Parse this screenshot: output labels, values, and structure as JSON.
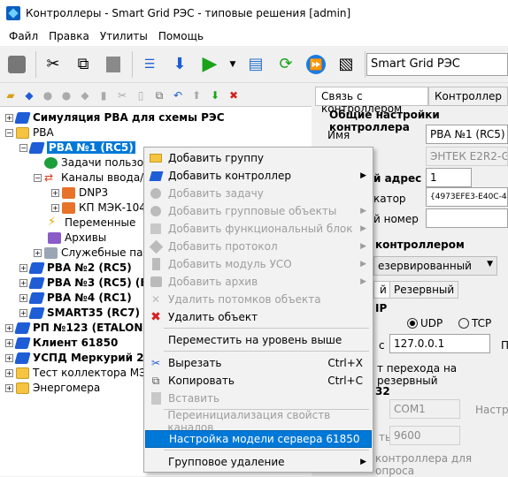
{
  "window": {
    "title": "Контроллеры - Smart Grid РЭС - типовые решения [admin]"
  },
  "menubar": [
    "Файл",
    "Правка",
    "Утилиты",
    "Помощь"
  ],
  "toolbar": {
    "profile": "Smart Grid РЭС"
  },
  "tree": {
    "items": [
      {
        "label": "Симуляция РВА для схемы РЭС",
        "bold": true
      },
      {
        "label": "РВА",
        "bold": false
      },
      {
        "label": "РВА №1 (RC5)",
        "bold": true
      },
      {
        "label": "Задачи пользо",
        "bold": false
      },
      {
        "label": "Каналы ввода/в",
        "bold": false
      },
      {
        "label": "DNP3",
        "bold": false
      },
      {
        "label": "КП МЭК-104",
        "bold": false
      },
      {
        "label": "Переменные",
        "bold": false
      },
      {
        "label": "Архивы",
        "bold": false
      },
      {
        "label": "Служебные па",
        "bold": false
      },
      {
        "label": "РВА №2 (RC5)",
        "bold": true
      },
      {
        "label": "РВА №3 (RC5) (E1",
        "bold": true
      },
      {
        "label": "РВА №4 (RC1)",
        "bold": true
      },
      {
        "label": "SMART35 (RC7)",
        "bold": true
      },
      {
        "label": "РП №123 (ETALON)",
        "bold": true
      },
      {
        "label": "Клиент 61850",
        "bold": true
      },
      {
        "label": "УСПД Меркурий 250",
        "bold": true
      },
      {
        "label": "Тест коллектора МЭК",
        "bold": false
      },
      {
        "label": "Энергомера",
        "bold": false
      }
    ]
  },
  "right_panel": {
    "tabs": [
      "Связь с контроллером",
      "Контроллер"
    ],
    "section_general": "Общие настройки контроллера",
    "name_label": "Имя",
    "name_value": "РВА №1 (RC5)",
    "model_value": "ЭНТЕК E2R2-G",
    "addr_label": "й адрес",
    "addr_value": "1",
    "id_label": "катор",
    "id_value": "{4973EFE3-E40C-447",
    "num_label": "й номер",
    "section_link": "контроллером",
    "mode_value": "езервированный",
    "subtabs": [
      "й",
      "Резервный"
    ],
    "proto_label": "IP",
    "udp": "UDP",
    "tcp": "TCP",
    "ip_label": "с",
    "ip_value": "127.0.0.1",
    "port_label": "П",
    "switch_label": "т перехода на резервный",
    "section_serial": "32",
    "com_value": "COM1",
    "settings_label": "Настро",
    "baud_label": "ть",
    "baud_value": "9600",
    "bottom_text": "контроллера для опроса"
  },
  "context_menu": {
    "items": [
      {
        "label": "Добавить группу",
        "icon": "folder-icon",
        "disabled": false,
        "submenu": false
      },
      {
        "label": "Добавить контроллер",
        "icon": "controller-icon",
        "disabled": false,
        "submenu": true
      },
      {
        "label": "Добавить задачу",
        "icon": "task-icon",
        "disabled": true,
        "submenu": false
      },
      {
        "label": "Добавить групповые объекты",
        "icon": "group-objects-icon",
        "disabled": true,
        "submenu": true
      },
      {
        "label": "Добавить функциональный блок",
        "icon": "function-block-icon",
        "disabled": true,
        "submenu": true
      },
      {
        "label": "Добавить протокол",
        "icon": "protocol-icon",
        "disabled": true,
        "submenu": true
      },
      {
        "label": "Добавить модуль УСО",
        "icon": "module-icon",
        "disabled": true,
        "submenu": true
      },
      {
        "label": "Добавить архив",
        "icon": "archive-icon",
        "disabled": true,
        "submenu": true
      },
      {
        "label": "Удалить потомков объекта",
        "icon": "delete-children-icon",
        "disabled": true,
        "submenu": false
      },
      {
        "label": "Удалить объект",
        "icon": "delete-icon",
        "disabled": false,
        "submenu": false
      },
      {
        "label": "Переместить на уровень выше",
        "icon": "",
        "disabled": false,
        "submenu": false
      },
      {
        "label": "Вырезать",
        "icon": "cut-icon",
        "disabled": false,
        "submenu": false,
        "shortcut": "Ctrl+X"
      },
      {
        "label": "Копировать",
        "icon": "copy-icon",
        "disabled": false,
        "submenu": false,
        "shortcut": "Ctrl+C"
      },
      {
        "label": "Вставить",
        "icon": "paste-icon",
        "disabled": true,
        "submenu": false
      },
      {
        "label": "Переинициализация свойств каналов",
        "icon": "",
        "disabled": true,
        "submenu": false
      },
      {
        "label": "Настройка модели сервера 61850",
        "icon": "",
        "disabled": false,
        "submenu": false,
        "highlighted": true
      },
      {
        "label": "Групповое удаление",
        "icon": "",
        "disabled": false,
        "submenu": true
      }
    ]
  }
}
